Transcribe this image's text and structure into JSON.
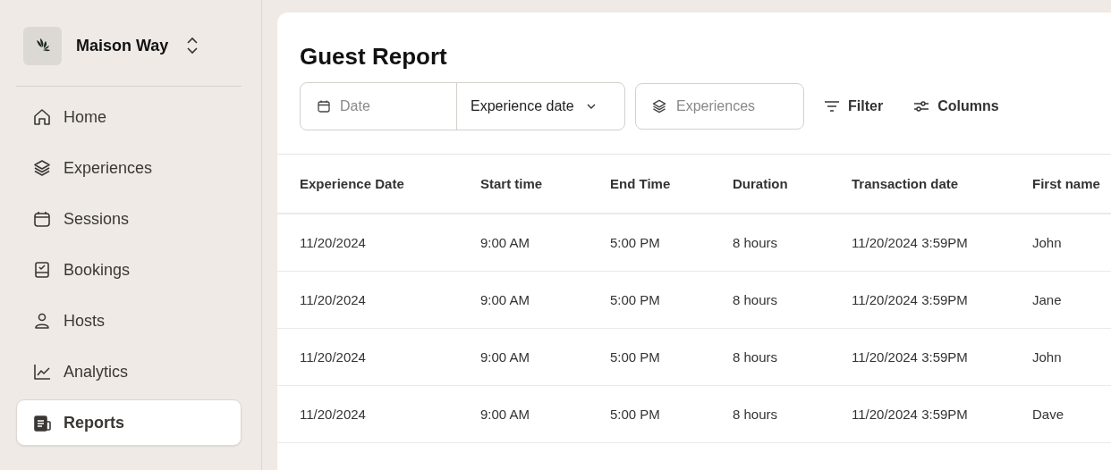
{
  "workspace": {
    "name": "Maison Way"
  },
  "sidebar": {
    "items": [
      {
        "label": "Home",
        "selected": false
      },
      {
        "label": "Experiences",
        "selected": false
      },
      {
        "label": "Sessions",
        "selected": false
      },
      {
        "label": "Bookings",
        "selected": false
      },
      {
        "label": "Hosts",
        "selected": false
      },
      {
        "label": "Analytics",
        "selected": false
      },
      {
        "label": "Reports",
        "selected": true
      }
    ]
  },
  "page": {
    "title": "Guest Report"
  },
  "toolbar": {
    "date_field": {
      "placeholder": "Date"
    },
    "date_type": {
      "value": "Experience date"
    },
    "experiences_field": {
      "placeholder": "Experiences"
    },
    "filter": "Filter",
    "columns": "Columns"
  },
  "table": {
    "columns": [
      "Experience Date",
      "Start time",
      "End Time",
      "Duration",
      "Transaction date",
      "First name"
    ],
    "rows": [
      [
        "11/20/2024",
        "9:00 AM",
        "5:00 PM",
        "8 hours",
        "11/20/2024 3:59PM",
        "John"
      ],
      [
        "11/20/2024",
        "9:00 AM",
        "5:00 PM",
        "8 hours",
        "11/20/2024 3:59PM",
        "Jane"
      ],
      [
        "11/20/2024",
        "9:00 AM",
        "5:00 PM",
        "8 hours",
        "11/20/2024 3:59PM",
        "John"
      ],
      [
        "11/20/2024",
        "9:00 AM",
        "5:00 PM",
        "8 hours",
        "11/20/2024 3:59PM",
        "Dave"
      ]
    ]
  }
}
